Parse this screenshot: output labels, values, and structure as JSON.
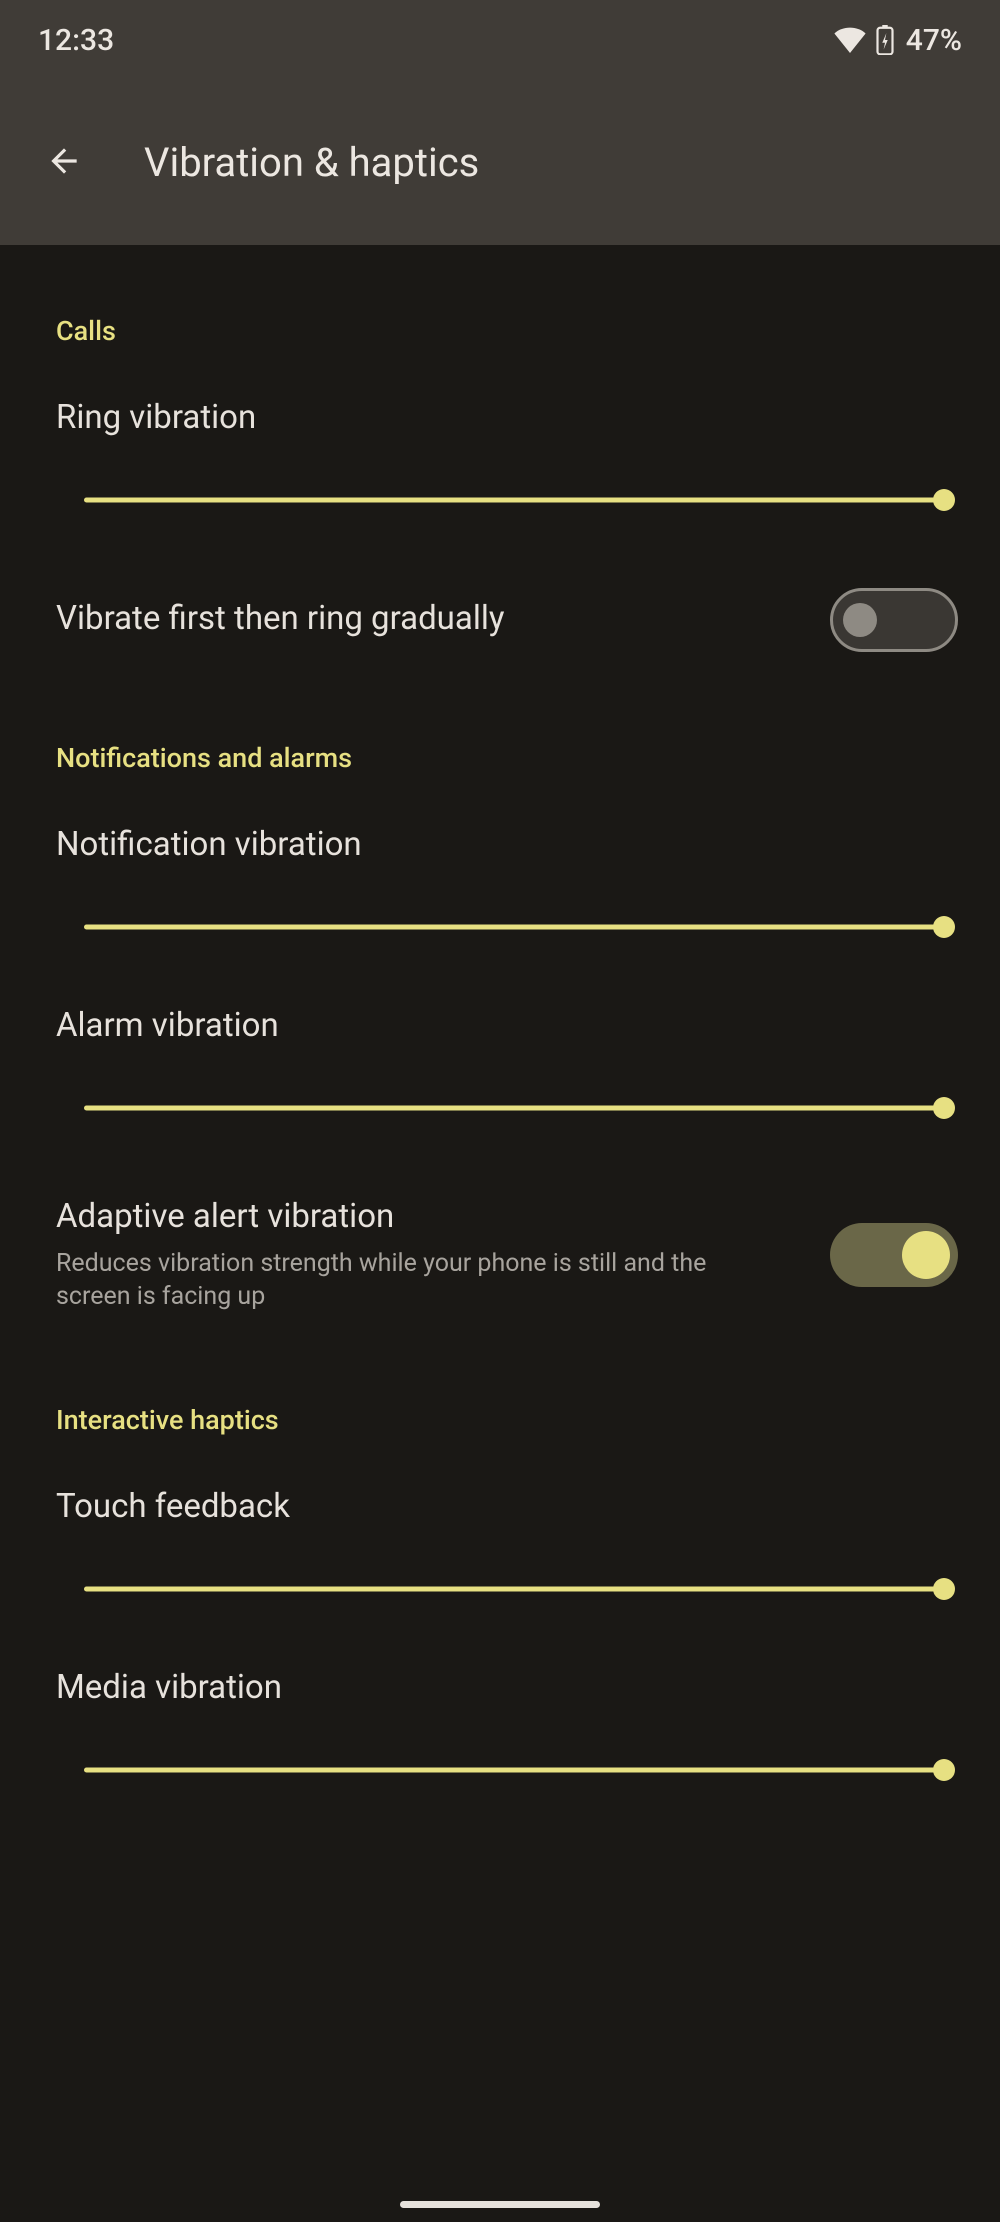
{
  "status": {
    "time": "12:33",
    "battery_pct": "47%"
  },
  "header": {
    "title": "Vibration & haptics"
  },
  "colors": {
    "accent": "#e7e082"
  },
  "sections": {
    "calls": {
      "label": "Calls",
      "ring_vibration": {
        "title": "Ring vibration",
        "value": 100
      },
      "vibrate_first": {
        "title": "Vibrate first then ring gradually",
        "on": false
      }
    },
    "notifications": {
      "label": "Notifications and alarms",
      "notification_vibration": {
        "title": "Notification vibration",
        "value": 100
      },
      "alarm_vibration": {
        "title": "Alarm vibration",
        "value": 100
      },
      "adaptive": {
        "title": "Adaptive alert vibration",
        "desc": "Reduces vibration strength while your phone is still and the screen is facing up",
        "on": true
      }
    },
    "interactive": {
      "label": "Interactive haptics",
      "touch_feedback": {
        "title": "Touch feedback",
        "value": 100
      },
      "media_vibration": {
        "title": "Media vibration",
        "value": 100
      }
    }
  }
}
